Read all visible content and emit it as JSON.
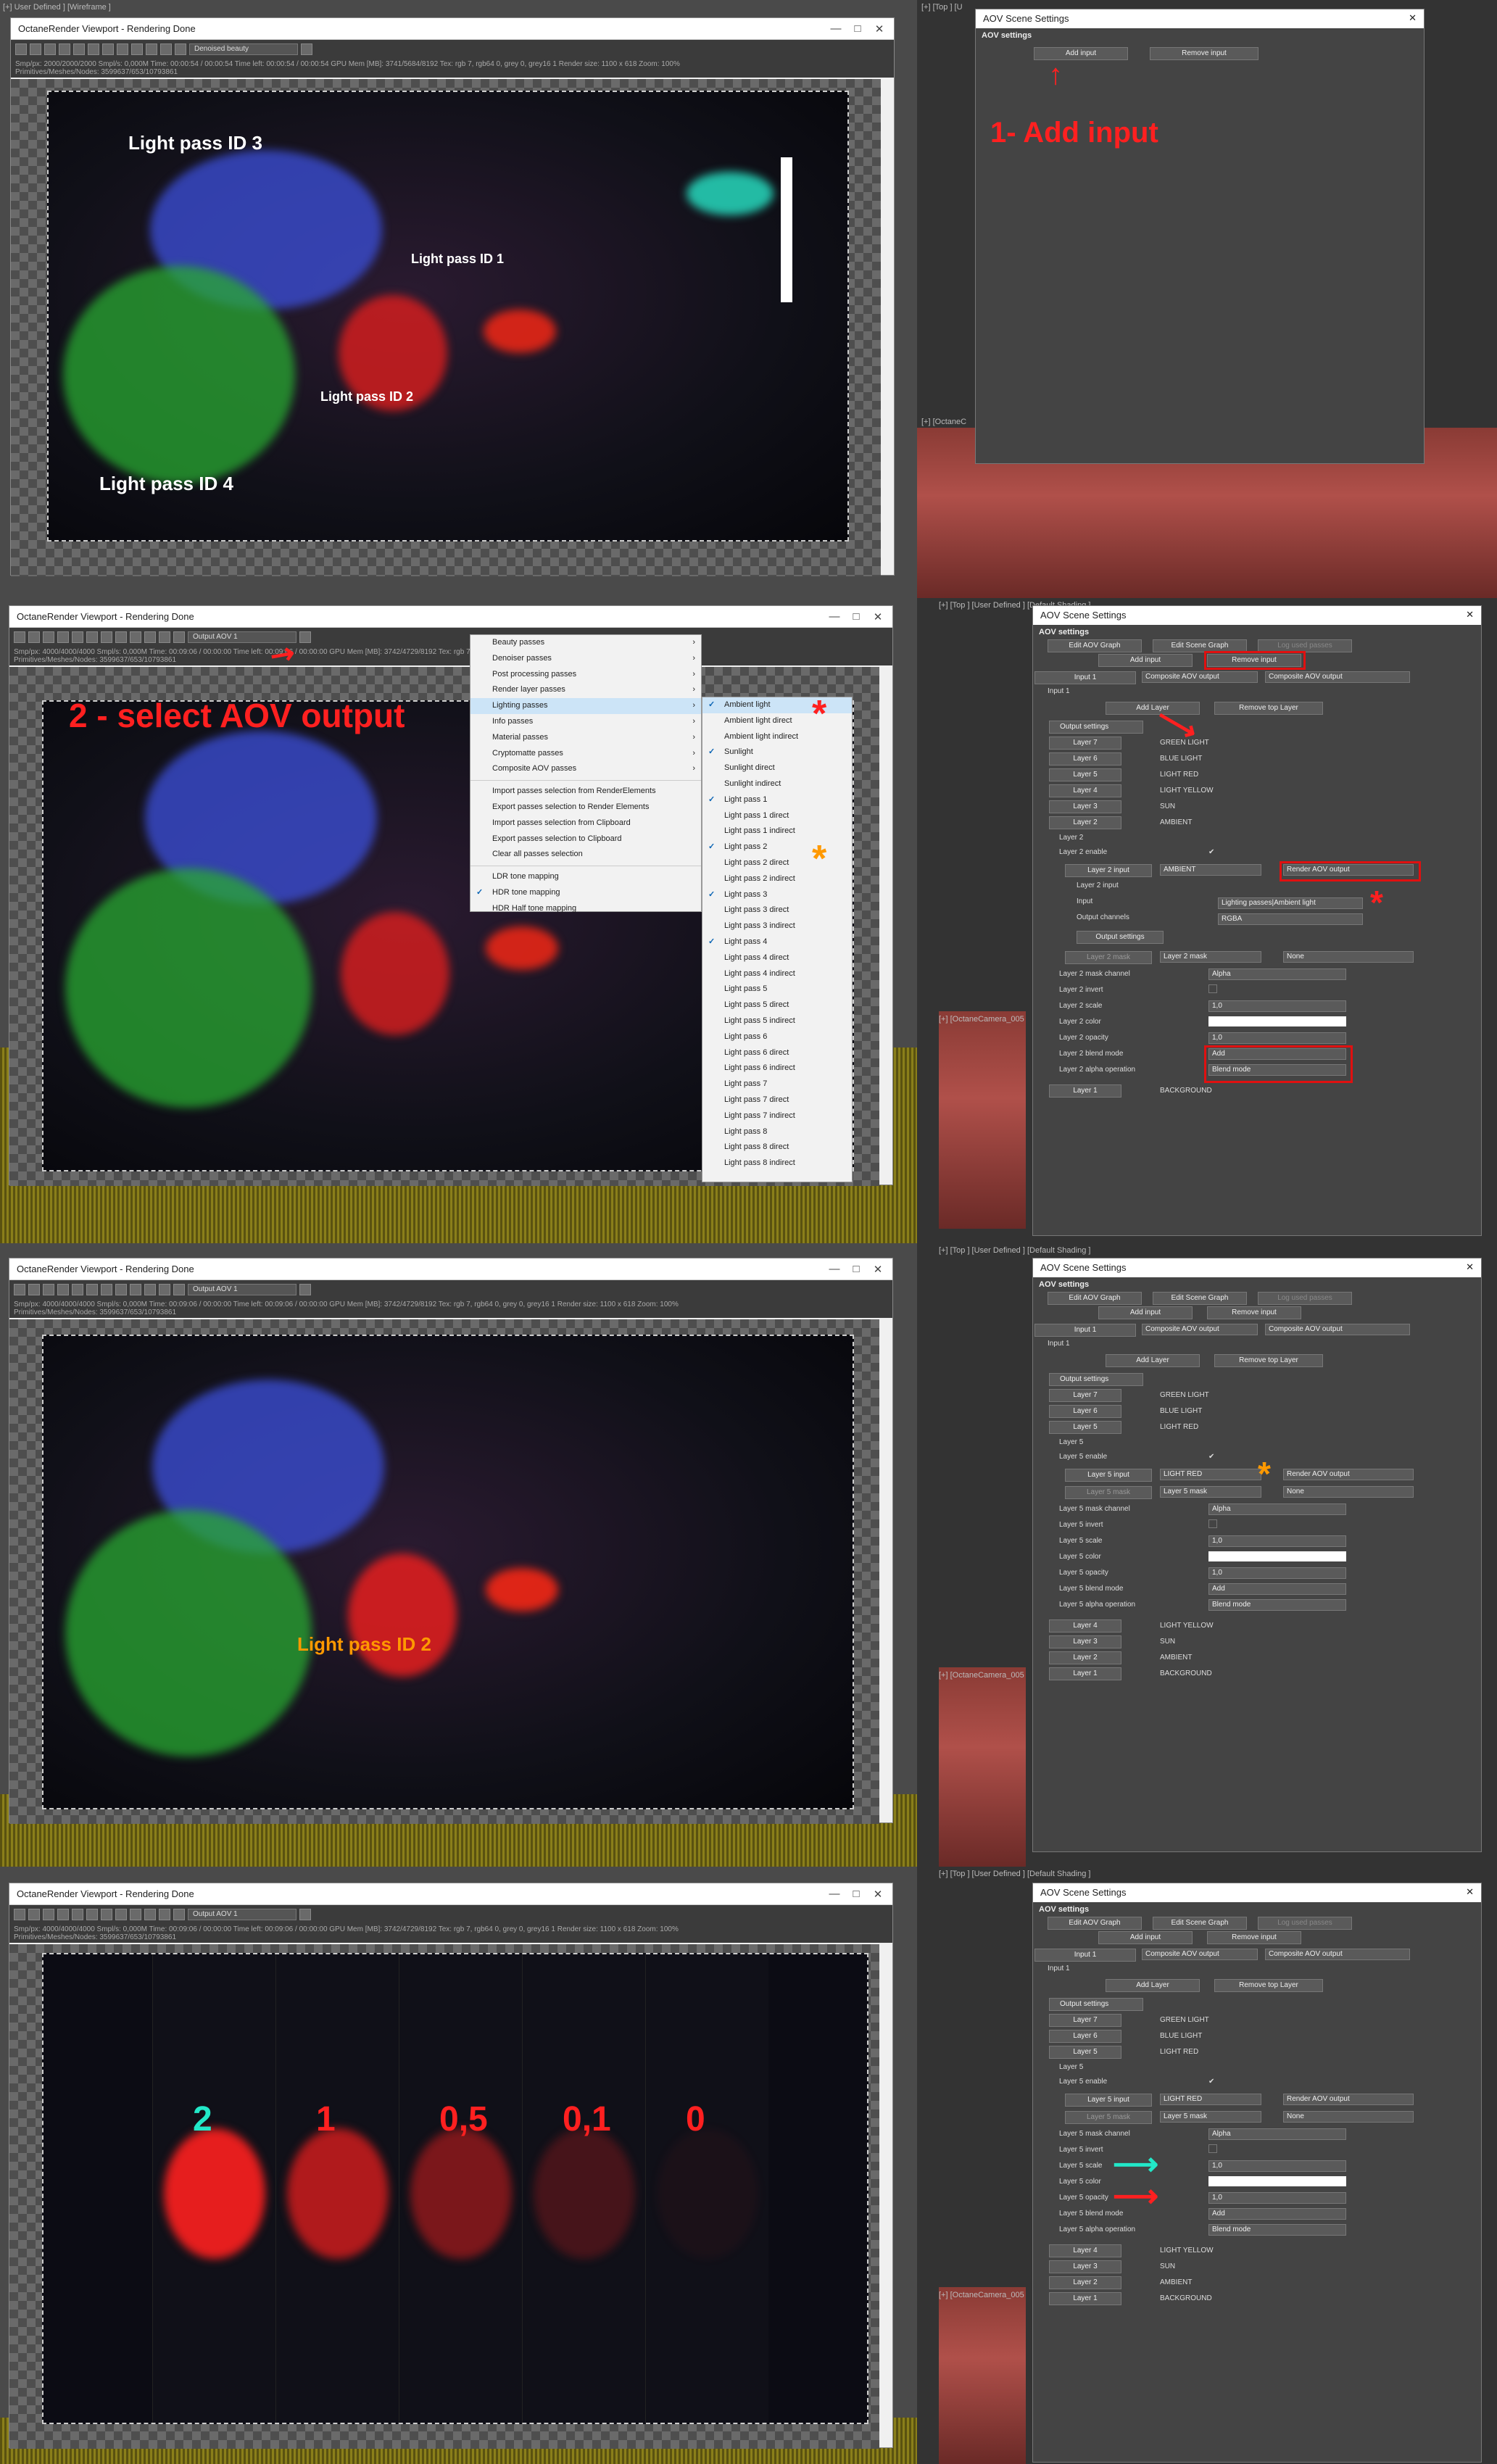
{
  "panel1": {
    "viewport_tab": "[+] User Defined ] [Wireframe ]",
    "window_title": "OctaneRender Viewport - Rendering Done",
    "toolbar_select": "Denoised beauty",
    "status_line1": "Smp/px: 2000/2000/2000    Smpl/s: 0,000M    Time: 00:00:54 / 00:00:54    Time left: 00:00:54 / 00:00:54    GPU Mem [MB]: 3741/5684/8192    Tex: rgb 7, rgb64 0, grey 0, grey16 1    Render size: 1100 x 618    Zoom: 100%",
    "status_line2": "Primitives/Meshes/Nodes: 3599637/653/10793861",
    "labels": [
      "Light pass ID 3",
      "Light pass ID 1",
      "Light pass ID 2",
      "Light pass ID 4"
    ],
    "right_tab_top": "[+] [Top ] [U",
    "right_tab_bottom": "[+] [OctaneC",
    "aov_title": "AOV Scene Settings",
    "aov_section": "AOV settings",
    "add_input": "Add input",
    "remove_input": "Remove input",
    "annotation": "1- Add input"
  },
  "panel2": {
    "window_title": "OctaneRender Viewport - Rendering Done",
    "toolbar_select": "Output AOV 1",
    "status_line1": "Smp/px: 4000/4000/4000    Smpl/s: 0,000M    Time: 00:09:06 / 00:00:00    Time left: 00:09:06 / 00:00:00    GPU Mem [MB]: 3742/4729/8192    Tex: rgb 7, rgb64 0, grey 0, grey16 1    Render size: 1100 x 618    Zoom: 100%",
    "status_line2": "Primitives/Meshes/Nodes: 3599637/653/10793861",
    "annotation": "2 - select AOV output",
    "menu_main": [
      "Beauty passes",
      "Denoiser passes",
      "Post processing passes",
      "Render layer passes",
      "Lighting passes",
      "Info passes",
      "Material passes",
      "Cryptomatte passes",
      "Composite AOV passes"
    ],
    "menu_actions": [
      "Import passes selection from RenderElements",
      "Export passes selection to Render Elements",
      "Import passes selection from Clipboard",
      "Export passes selection to Clipboard",
      "Clear all passes selection"
    ],
    "menu_tone": [
      "LDR tone mapping",
      "HDR tone mapping",
      "HDR Half tone mapping"
    ],
    "submenu": [
      "Ambient light",
      "Ambient light direct",
      "Ambient light indirect",
      "Sunlight",
      "Sunlight direct",
      "Sunlight indirect",
      "Light pass 1",
      "Light pass 1 direct",
      "Light pass 1 indirect",
      "Light pass 2",
      "Light pass 2 direct",
      "Light pass 2 indirect",
      "Light pass 3",
      "Light pass 3 direct",
      "Light pass 3 indirect",
      "Light pass 4",
      "Light pass 4 direct",
      "Light pass 4 indirect",
      "Light pass 5",
      "Light pass 5 direct",
      "Light pass 5 indirect",
      "Light pass 6",
      "Light pass 6 direct",
      "Light pass 6 indirect",
      "Light pass 7",
      "Light pass 7 direct",
      "Light pass 7 indirect",
      "Light pass 8",
      "Light pass 8 direct",
      "Light pass 8 indirect"
    ],
    "right_tab_top": "[+] [Top ] [User Defined ] [Default Shading ]",
    "right_tab_bottom": "[+] [OctaneCamera_005",
    "aov": {
      "title": "AOV Scene Settings",
      "section": "AOV settings",
      "edit_aov_graph": "Edit AOV Graph",
      "edit_scene_graph": "Edit Scene Graph",
      "log_used_passes": "Log used passes",
      "add_input": "Add input",
      "remove_input": "Remove input",
      "input1": "Input 1",
      "composite_left": "Composite AOV output",
      "composite_right": "Composite AOV output",
      "input1_label": "Input 1",
      "add_layer": "Add Layer",
      "remove_top_layer": "Remove top Layer",
      "output_settings": "Output settings",
      "layers": [
        [
          "Layer 7",
          "GREEN LIGHT"
        ],
        [
          "Layer 6",
          "BLUE LIGHT"
        ],
        [
          "Layer 5",
          "LIGHT RED"
        ],
        [
          "Layer 4",
          "LIGHT YELLOW"
        ],
        [
          "Layer 3",
          "SUN"
        ],
        [
          "Layer 2",
          "AMBIENT"
        ]
      ],
      "layer_heading": "Layer 2",
      "enable_label": "Layer 2 enable",
      "input_btn": "Layer 2 input",
      "input_value": "AMBIENT",
      "render_aov": "Render AOV output",
      "sub_input_label": "Layer 2 input",
      "input_label": "Input",
      "input_pass": "Lighting passes|Ambient light",
      "out_channels_label": "Output channels",
      "out_channels": "RGBA",
      "sub_output_settings": "Output settings",
      "mask_btn": "Layer 2 mask",
      "mask_value": "Layer 2 mask",
      "mask_none": "None",
      "props": [
        [
          "Layer 2 mask channel",
          "Alpha"
        ],
        [
          "Layer 2 invert",
          ""
        ],
        [
          "Layer 2 scale",
          "1,0"
        ],
        [
          "Layer 2 color",
          ""
        ],
        [
          "Layer 2 opacity",
          "1,0"
        ],
        [
          "Layer 2 blend mode",
          "Add"
        ],
        [
          "Layer 2 alpha operation",
          "Blend mode"
        ]
      ],
      "last_layer": [
        "Layer 1",
        "BACKGROUND"
      ]
    }
  },
  "panel3": {
    "window_title": "OctaneRender Viewport - Rendering Done",
    "toolbar_select": "Output AOV 1",
    "status_line1": "Smp/px: 4000/4000/4000    Smpl/s: 0,000M    Time: 00:09:06 / 00:00:00    Time left: 00:09:06 / 00:00:00    GPU Mem [MB]: 3742/4729/8192    Tex: rgb 7, rgb64 0, grey 0, grey16 1    Render size: 1100 x 618    Zoom: 100%",
    "status_line2": "Primitives/Meshes/Nodes: 3599637/653/10793861",
    "label": "Light pass ID 2",
    "aov": {
      "title": "AOV Scene Settings",
      "section": "AOV settings",
      "edit_aov_graph": "Edit AOV Graph",
      "edit_scene_graph": "Edit Scene Graph",
      "log_used_passes": "Log used passes",
      "add_input": "Add input",
      "remove_input": "Remove input",
      "input1": "Input 1",
      "composite_left": "Composite AOV output",
      "composite_right": "Composite AOV output",
      "input1_label": "Input 1",
      "add_layer": "Add Layer",
      "remove_top_layer": "Remove top Layer",
      "output_settings": "Output settings",
      "layers": [
        [
          "Layer 7",
          "GREEN LIGHT"
        ],
        [
          "Layer 6",
          "BLUE LIGHT"
        ],
        [
          "Layer 5",
          "LIGHT RED"
        ]
      ],
      "layer_heading": "Layer 5",
      "enable_label": "Layer 5 enable",
      "input_btn": "Layer 5 input",
      "input_value": "LIGHT RED",
      "render_aov": "Render AOV output",
      "mask_btn": "Layer 5 mask",
      "mask_value": "Layer 5 mask",
      "mask_none": "None",
      "props": [
        [
          "Layer 5 mask channel",
          "Alpha"
        ],
        [
          "Layer 5 invert",
          ""
        ],
        [
          "Layer 5 scale",
          "1,0"
        ],
        [
          "Layer 5 color",
          ""
        ],
        [
          "Layer 5 opacity",
          "1,0"
        ],
        [
          "Layer 5 blend mode",
          "Add"
        ],
        [
          "Layer 5 alpha operation",
          "Blend mode"
        ]
      ],
      "rest_layers": [
        [
          "Layer 4",
          "LIGHT YELLOW"
        ],
        [
          "Layer 3",
          "SUN"
        ],
        [
          "Layer 2",
          "AMBIENT"
        ],
        [
          "Layer 1",
          "BACKGROUND"
        ]
      ]
    }
  },
  "panel4": {
    "window_title": "OctaneRender Viewport - Rendering Done",
    "toolbar_select": "Output AOV 1",
    "status_line1": "Smp/px: 4000/4000/4000    Smpl/s: 0,000M    Time: 00:09:06 / 00:00:00    Time left: 00:09:06 / 00:00:00    GPU Mem [MB]: 3742/4729/8192    Tex: rgb 7, rgb64 0, grey 0, grey16 1    Render size: 1100 x 618    Zoom: 100%",
    "status_line2": "Primitives/Meshes/Nodes: 3599637/653/10793861",
    "strip_values": [
      "2",
      "1",
      "0,5",
      "0,1",
      "0"
    ],
    "aov": {
      "title": "AOV Scene Settings",
      "section": "AOV settings",
      "edit_aov_graph": "Edit AOV Graph",
      "edit_scene_graph": "Edit Scene Graph",
      "log_used_passes": "Log used passes",
      "add_input": "Add input",
      "remove_input": "Remove input",
      "input1": "Input 1",
      "composite_left": "Composite AOV output",
      "composite_right": "Composite AOV output",
      "input1_label": "Input 1",
      "add_layer": "Add Layer",
      "remove_top_layer": "Remove top Layer",
      "output_settings": "Output settings",
      "layers": [
        [
          "Layer 7",
          "GREEN LIGHT"
        ],
        [
          "Layer 6",
          "BLUE LIGHT"
        ],
        [
          "Layer 5",
          "LIGHT RED"
        ]
      ],
      "layer_heading": "Layer 5",
      "enable_label": "Layer 5 enable",
      "input_btn": "Layer 5 input",
      "input_value": "LIGHT RED",
      "render_aov": "Render AOV output",
      "mask_btn": "Layer 5 mask",
      "mask_value": "Layer 5 mask",
      "mask_none": "None",
      "props": [
        [
          "Layer 5 mask channel",
          "Alpha"
        ],
        [
          "Layer 5 invert",
          ""
        ],
        [
          "Layer 5 scale",
          "1,0"
        ],
        [
          "Layer 5 color",
          ""
        ],
        [
          "Layer 5 opacity",
          "1,0"
        ],
        [
          "Layer 5 blend mode",
          "Add"
        ],
        [
          "Layer 5 alpha operation",
          "Blend mode"
        ]
      ],
      "rest_layers": [
        [
          "Layer 4",
          "LIGHT YELLOW"
        ],
        [
          "Layer 3",
          "SUN"
        ],
        [
          "Layer 2",
          "AMBIENT"
        ],
        [
          "Layer 1",
          "BACKGROUND"
        ]
      ]
    }
  },
  "colors": {
    "annotation_red": "#ff2020",
    "annotation_orange": "#ff9900",
    "annotation_cyan": "#22e8c8"
  }
}
